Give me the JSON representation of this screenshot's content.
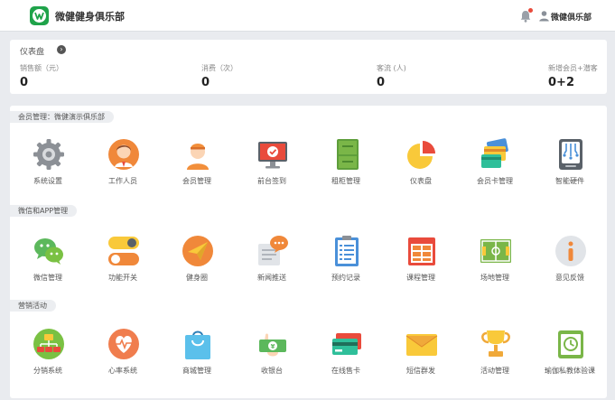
{
  "header": {
    "app_name": "微健健身俱乐部",
    "user_name": "微健俱乐部"
  },
  "dashboard": {
    "title": "仪表盘",
    "stats": [
      {
        "label": "销售额（元）",
        "value": "0"
      },
      {
        "label": "消费（次）",
        "value": "0"
      },
      {
        "label": "客流 (人)",
        "value": "0"
      },
      {
        "label": "新增会员+潜客",
        "value": "0+2"
      }
    ]
  },
  "sections": [
    {
      "title": "会员管理：微健演示俱乐部",
      "items": [
        {
          "label": "系统设置",
          "icon": "gear-icon"
        },
        {
          "label": "工作人员",
          "icon": "staff-icon"
        },
        {
          "label": "会员管理",
          "icon": "member-icon"
        },
        {
          "label": "前台签到",
          "icon": "checkin-monitor-icon"
        },
        {
          "label": "租柜管理",
          "icon": "locker-icon"
        },
        {
          "label": "仪表盘",
          "icon": "pie-chart-icon"
        },
        {
          "label": "会员卡管理",
          "icon": "member-card-icon"
        },
        {
          "label": "智能硬件",
          "icon": "hardware-icon"
        }
      ]
    },
    {
      "title": "微信和APP管理",
      "items": [
        {
          "label": "微信管理",
          "icon": "wechat-icon"
        },
        {
          "label": "功能开关",
          "icon": "toggle-icon"
        },
        {
          "label": "健身圈",
          "icon": "paper-plane-icon"
        },
        {
          "label": "新闻推送",
          "icon": "news-icon"
        },
        {
          "label": "预约记录",
          "icon": "clipboard-icon"
        },
        {
          "label": "课程管理",
          "icon": "calendar-icon"
        },
        {
          "label": "场地管理",
          "icon": "field-icon"
        },
        {
          "label": "意见反馈",
          "icon": "info-icon"
        }
      ]
    },
    {
      "title": "营销活动",
      "items": [
        {
          "label": "分销系统",
          "icon": "distribution-icon"
        },
        {
          "label": "心率系统",
          "icon": "heart-rate-icon"
        },
        {
          "label": "商城管理",
          "icon": "shopping-bag-icon"
        },
        {
          "label": "收银台",
          "icon": "cashier-icon"
        },
        {
          "label": "在线售卡",
          "icon": "card-sale-icon"
        },
        {
          "label": "短信群发",
          "icon": "envelope-icon"
        },
        {
          "label": "活动管理",
          "icon": "trophy-icon"
        },
        {
          "label": "瑜伽私教体验课",
          "icon": "yoga-clock-icon"
        }
      ]
    }
  ]
}
